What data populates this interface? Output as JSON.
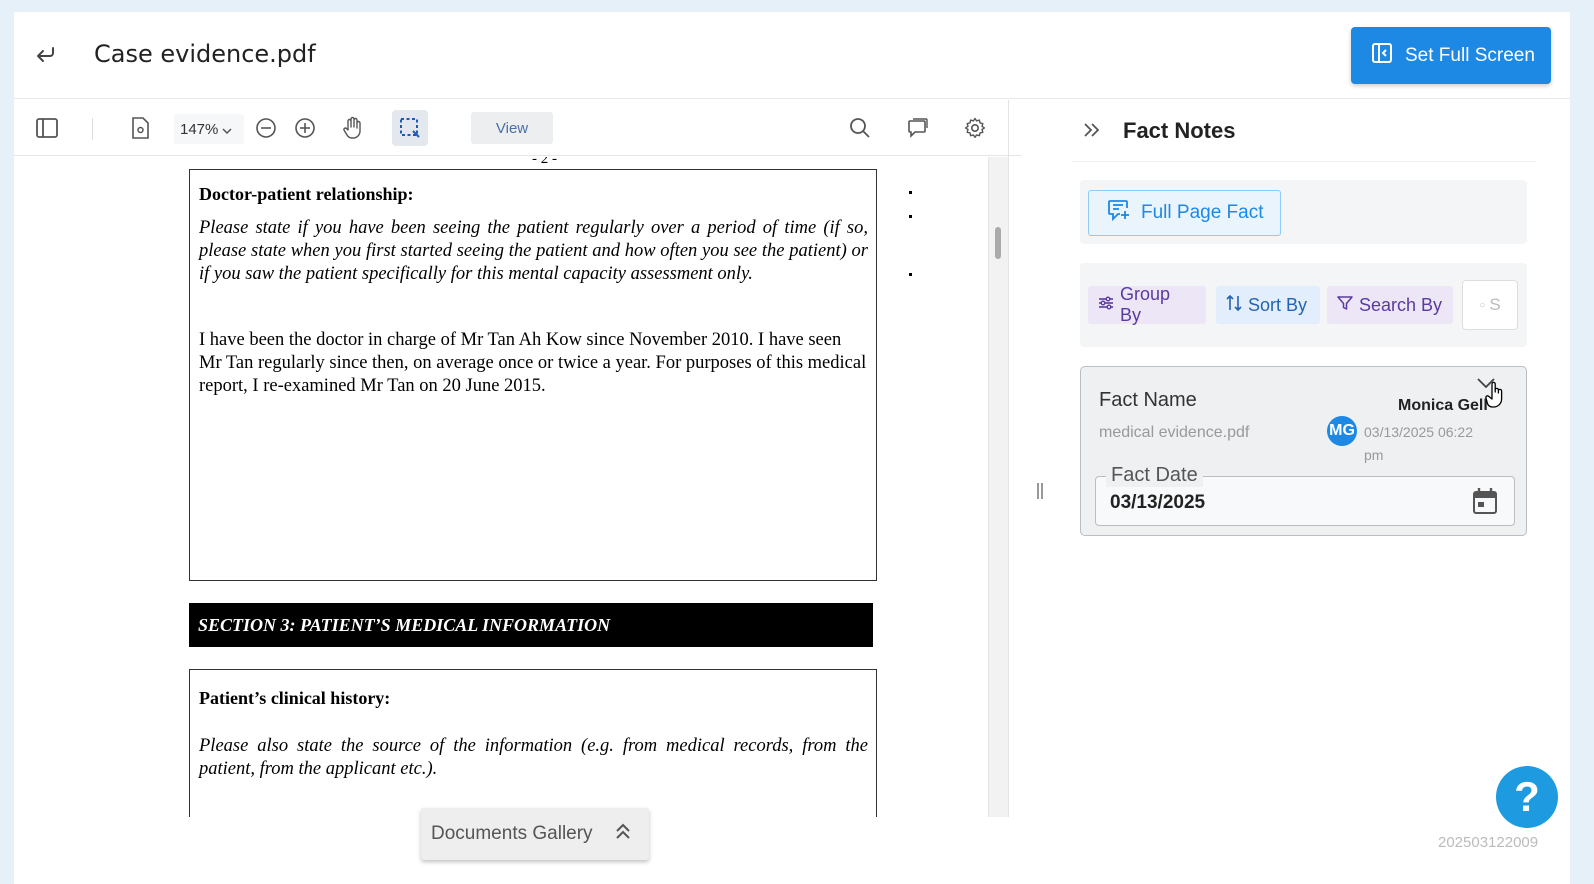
{
  "header": {
    "title": "Case evidence.pdf",
    "fullscreen_label": "Set Full Screen"
  },
  "toolbar": {
    "zoom": "147%",
    "view_label": "View"
  },
  "document": {
    "page_number": "- 2 -",
    "box1_heading": "Doctor-patient relationship:",
    "box1_question": "Please state if you have been seeing the patient regularly over a period of time (if so, please state when you first started seeing the patient and how often you see the patient) or if you saw the patient specifically for this mental capacity assessment only.",
    "box1_answer": "I have been the doctor in charge of Mr Tan Ah Kow since November 2010. I have seen Mr Tan regularly since then, on average once or twice a year. For purposes of this medical report, I re-examined Mr Tan on 20 June 2015.",
    "section_title": "SECTION 3: PATIENT’S MEDICAL INFORMATION",
    "box2_heading": "Patient’s clinical history:",
    "box2_question": "Please also state the source of the information (e.g. from medical records, from the patient, from the applicant etc.)."
  },
  "gallery": {
    "label": "Documents Gallery"
  },
  "panel": {
    "title": "Fact Notes",
    "full_page_fact_label": "Full Page Fact",
    "group_by_label": "Group By",
    "sort_by_label": "Sort By",
    "search_by_label": "Search By",
    "search_placeholder": "S"
  },
  "fact_card": {
    "name": "Fact Name",
    "file": "medical evidence.pdf",
    "user": "Monica Gell",
    "avatar_initials": "MG",
    "timestamp": "03/13/2025 06:22 pm",
    "date_label": "Fact Date",
    "date_value": "03/13/2025"
  },
  "footer": {
    "version": "202503122009",
    "help": "?"
  },
  "colors": {
    "primary": "#1e88e5",
    "help": "#1e9be0"
  }
}
